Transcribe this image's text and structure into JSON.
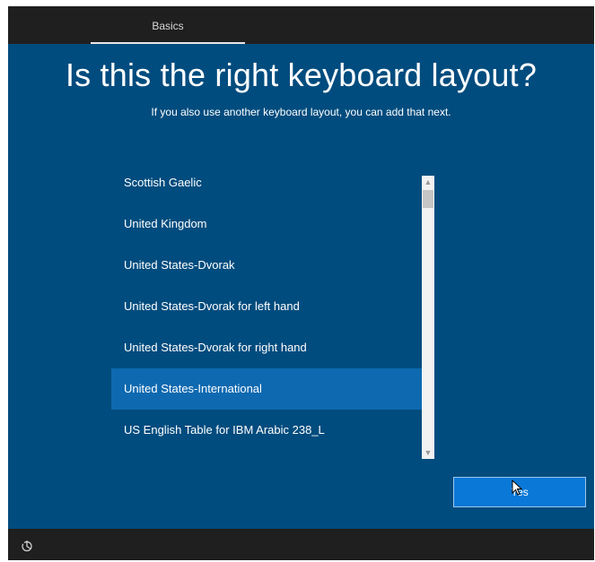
{
  "header": {
    "tabs": [
      {
        "label": "Basics",
        "active": true
      }
    ]
  },
  "main": {
    "title": "Is this the right keyboard layout?",
    "subtitle": "If you also use another keyboard layout, you can add that next.",
    "layouts": [
      {
        "label": "Scottish Gaelic",
        "selected": false
      },
      {
        "label": "United Kingdom",
        "selected": false
      },
      {
        "label": "United States-Dvorak",
        "selected": false
      },
      {
        "label": "United States-Dvorak for left hand",
        "selected": false
      },
      {
        "label": "United States-Dvorak for right hand",
        "selected": false
      },
      {
        "label": "United States-International",
        "selected": true
      },
      {
        "label": "US English Table for IBM Arabic 238_L",
        "selected": false
      }
    ]
  },
  "footer": {
    "yes_label": "Yes",
    "accessibility_icon": "ease-of-access-icon"
  },
  "colors": {
    "background": "#014c7e",
    "selected_item": "#0e69b0",
    "primary_button": "#0a78d7",
    "bar": "#1f1f1f"
  }
}
